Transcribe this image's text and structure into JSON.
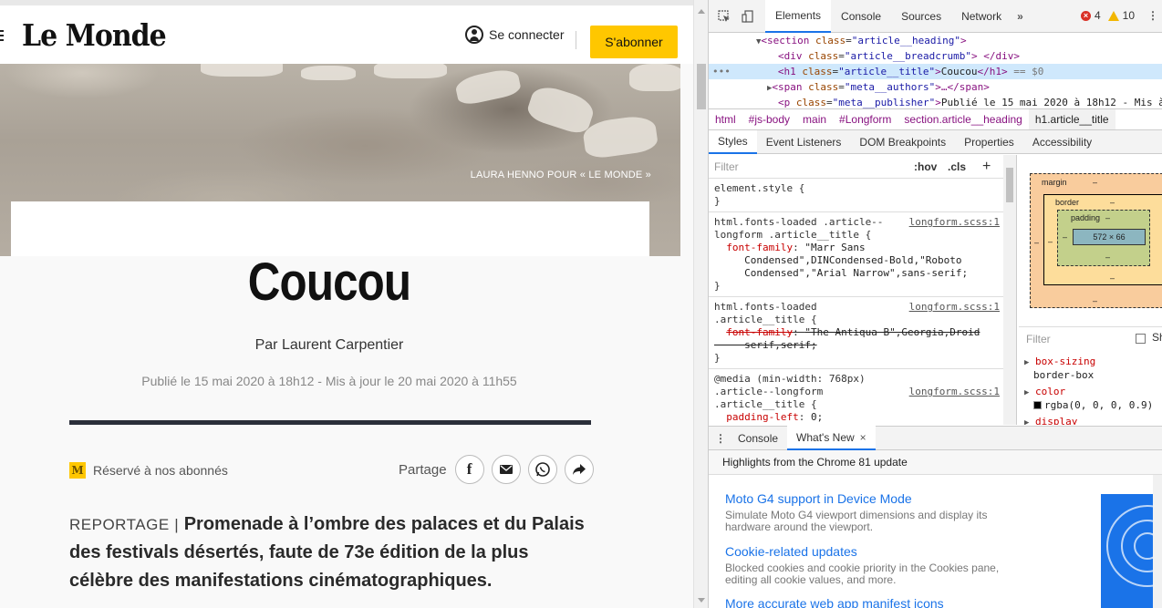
{
  "site": {
    "logo": "Le Monde",
    "connect_label": "Se connecter",
    "subscribe_label": "S'abonner",
    "photo_credit": "LAURA HENNO POUR « LE MONDE »",
    "title": "Coucou",
    "authors": "Par Laurent Carpentier",
    "publisher": "Publié le 15 mai 2020 à 18h12 - Mis à jour le 20 mai 2020 à 11h55",
    "reserved_badge": "M",
    "reserved_label": "Réservé à nos abonnés",
    "share_label": "Partage",
    "kicker": "REPORTAGE",
    "kicker_sep": "|",
    "lede": "Promenade à l’ombre des palaces et du Palais des festivals désertés, faute de 73e édition de la plus célèbre des manifestations cinématographiques."
  },
  "devtools": {
    "tabs": [
      "Elements",
      "Console",
      "Sources",
      "Network"
    ],
    "more_tabs": "»",
    "errors": "4",
    "warnings": "10",
    "dom": {
      "l1_tag": "section",
      "l1_attr": "class",
      "l1_val": "\"article__heading\"",
      "l2_tag": "div",
      "l2_attr": "class",
      "l2_val": "\"article__breadcrumb\"",
      "l2_close": "</div>",
      "l3_tag": "h1",
      "l3_attr": "class",
      "l3_val": "\"article__title\"",
      "l3_text": "Coucou",
      "l3_close": "</h1>",
      "l3_eq": "== $0",
      "l3_dots": "•••",
      "l4_tag": "span",
      "l4_attr": "class",
      "l4_val": "\"meta__authors\"",
      "l4_ell": "…</span>",
      "l5_tag": "p",
      "l5_attr": "class",
      "l5_val": "\"meta__publisher\"",
      "l5_text": "Publié le 15 mai 2020 à 18h12 - Mis à"
    },
    "breadcrumbs": [
      "html",
      "#js-body",
      "main",
      "#Longform",
      "section.article__heading",
      "h1.article__title"
    ],
    "sub_tabs": [
      "Styles",
      "Event Listeners",
      "DOM Breakpoints",
      "Properties",
      "Accessibility"
    ],
    "styles": {
      "filter_placeholder": "Filter",
      "hov": ":hov",
      "cls": ".cls",
      "plus": "+",
      "element_style": "element.style {",
      "close_brace": "}",
      "r1_selector": "html.fonts-loaded .article--\nlongform .article__title {",
      "r1_src": "longform.scss:1",
      "r1_prop": "font-family",
      "r1_val": "\"Marr Sans\n     Condensed\",DINCondensed-Bold,\"Roboto\n     Condensed\",\"Arial Narrow\",sans-serif;",
      "r2_selector": "html.fonts-loaded\n.article__title {",
      "r2_src": "longform.scss:1",
      "r2_prop": "font-family",
      "r2_val": "\"The Antiqua B\",Georgia,Droid\n     serif,serif;",
      "r3_selector": "@media (min-width: 768px)\n.article--longform\n.article__title {",
      "r3_src": "longform.scss:1",
      "r3_prop": "padding-left",
      "r3_val": "0;"
    },
    "box_model": {
      "margin_label": "margin",
      "border_label": "border",
      "padding_label": "padding",
      "dash": "–",
      "content_size": "572 × 66",
      "filter_placeholder": "Filter",
      "show_all": "Sh"
    },
    "computed": [
      {
        "prop": "box-sizing",
        "value": "border-box"
      },
      {
        "prop": "color",
        "value": "rgba(0, 0, 0, 0.9)"
      },
      {
        "prop": "display",
        "value": ""
      }
    ],
    "drawer": {
      "tabs": [
        "Console",
        "What's New"
      ],
      "close": "×",
      "heading": "Highlights from the Chrome 81 update",
      "items": [
        {
          "title": "Moto G4 support in Device Mode",
          "desc": "Simulate Moto G4 viewport dimensions and display its hardware around the viewport."
        },
        {
          "title": "Cookie-related updates",
          "desc": "Blocked cookies and cookie priority in the Cookies pane, editing all cookie values, and more."
        },
        {
          "title": "More accurate web app manifest icons",
          "desc": ""
        }
      ]
    }
  },
  "colors": {
    "subscribe_bg": "#ffc700",
    "devtools_accent": "#1a73e8",
    "dom_tag": "#881280",
    "dom_attr": "#994500",
    "dom_value": "#1a1aa6"
  }
}
